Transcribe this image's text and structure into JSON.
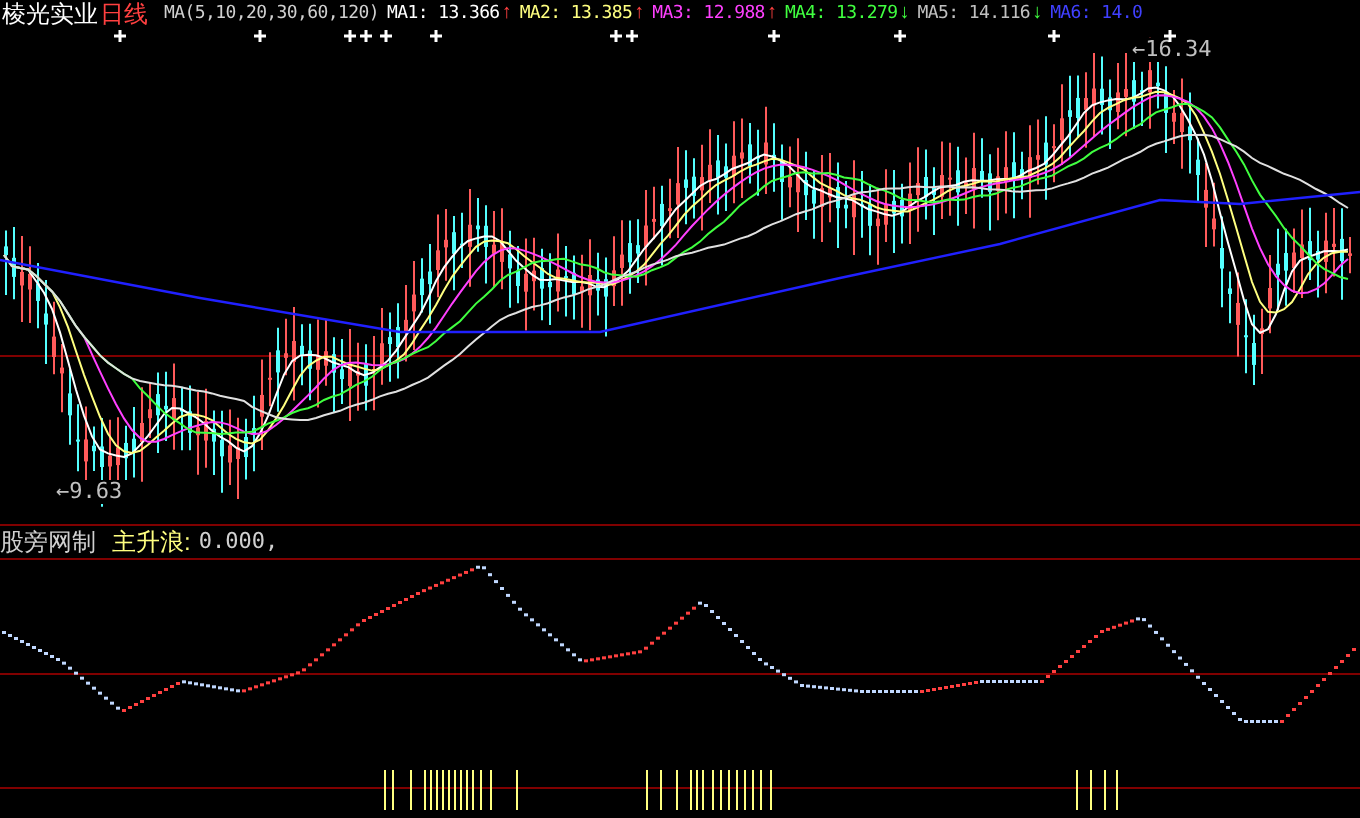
{
  "header": {
    "stock_name": "棱光实业",
    "period": "日线",
    "indicator": "MA(5,10,20,30,60,120)",
    "ma_values": [
      {
        "label": "MA1:",
        "value": "13.366",
        "arrow": "↑",
        "rising": true,
        "color": "#ffffff"
      },
      {
        "label": "MA2:",
        "value": "13.385",
        "arrow": "↑",
        "rising": true,
        "color": "#ffff80"
      },
      {
        "label": "MA3:",
        "value": "12.988",
        "arrow": "↑",
        "rising": true,
        "color": "#ff40ff"
      },
      {
        "label": "MA4:",
        "value": "13.279",
        "arrow": "↓",
        "rising": false,
        "color": "#40ff40"
      },
      {
        "label": "MA5:",
        "value": "14.116",
        "arrow": "↓",
        "rising": false,
        "color": "#c0c0c0"
      },
      {
        "label": "MA6:",
        "value": "14.0",
        "color": "#4040ff"
      }
    ]
  },
  "main_chart": {
    "low_label": "←9.63",
    "high_label": "←16.34"
  },
  "sub_chart": {
    "source": "股旁网制",
    "indicator": "主升浪:",
    "value": "0.000,"
  }
}
